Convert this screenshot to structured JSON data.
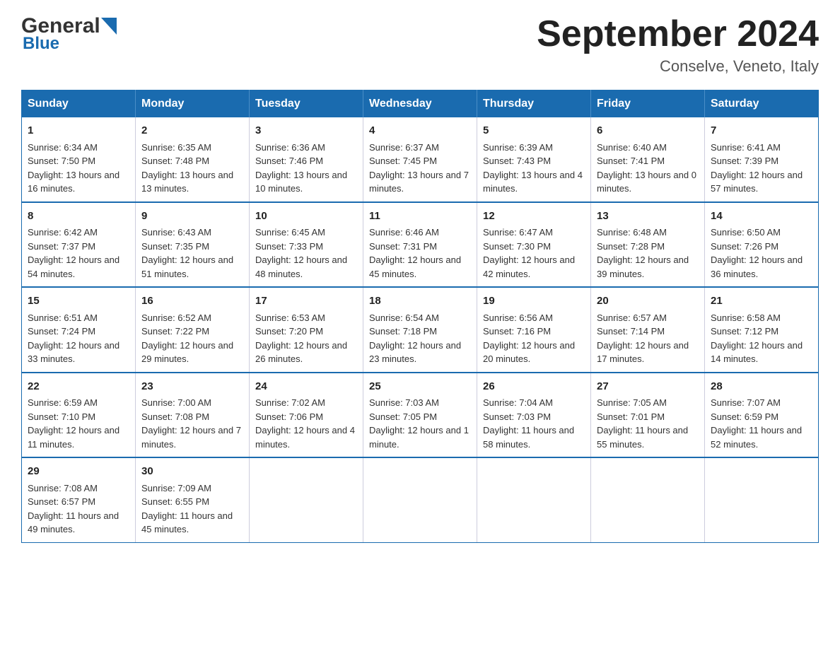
{
  "header": {
    "logo_general": "General",
    "logo_blue": "Blue",
    "month_title": "September 2024",
    "subtitle": "Conselve, Veneto, Italy"
  },
  "weekdays": [
    "Sunday",
    "Monday",
    "Tuesday",
    "Wednesday",
    "Thursday",
    "Friday",
    "Saturday"
  ],
  "weeks": [
    [
      {
        "day": "1",
        "sunrise": "Sunrise: 6:34 AM",
        "sunset": "Sunset: 7:50 PM",
        "daylight": "Daylight: 13 hours and 16 minutes."
      },
      {
        "day": "2",
        "sunrise": "Sunrise: 6:35 AM",
        "sunset": "Sunset: 7:48 PM",
        "daylight": "Daylight: 13 hours and 13 minutes."
      },
      {
        "day": "3",
        "sunrise": "Sunrise: 6:36 AM",
        "sunset": "Sunset: 7:46 PM",
        "daylight": "Daylight: 13 hours and 10 minutes."
      },
      {
        "day": "4",
        "sunrise": "Sunrise: 6:37 AM",
        "sunset": "Sunset: 7:45 PM",
        "daylight": "Daylight: 13 hours and 7 minutes."
      },
      {
        "day": "5",
        "sunrise": "Sunrise: 6:39 AM",
        "sunset": "Sunset: 7:43 PM",
        "daylight": "Daylight: 13 hours and 4 minutes."
      },
      {
        "day": "6",
        "sunrise": "Sunrise: 6:40 AM",
        "sunset": "Sunset: 7:41 PM",
        "daylight": "Daylight: 13 hours and 0 minutes."
      },
      {
        "day": "7",
        "sunrise": "Sunrise: 6:41 AM",
        "sunset": "Sunset: 7:39 PM",
        "daylight": "Daylight: 12 hours and 57 minutes."
      }
    ],
    [
      {
        "day": "8",
        "sunrise": "Sunrise: 6:42 AM",
        "sunset": "Sunset: 7:37 PM",
        "daylight": "Daylight: 12 hours and 54 minutes."
      },
      {
        "day": "9",
        "sunrise": "Sunrise: 6:43 AM",
        "sunset": "Sunset: 7:35 PM",
        "daylight": "Daylight: 12 hours and 51 minutes."
      },
      {
        "day": "10",
        "sunrise": "Sunrise: 6:45 AM",
        "sunset": "Sunset: 7:33 PM",
        "daylight": "Daylight: 12 hours and 48 minutes."
      },
      {
        "day": "11",
        "sunrise": "Sunrise: 6:46 AM",
        "sunset": "Sunset: 7:31 PM",
        "daylight": "Daylight: 12 hours and 45 minutes."
      },
      {
        "day": "12",
        "sunrise": "Sunrise: 6:47 AM",
        "sunset": "Sunset: 7:30 PM",
        "daylight": "Daylight: 12 hours and 42 minutes."
      },
      {
        "day": "13",
        "sunrise": "Sunrise: 6:48 AM",
        "sunset": "Sunset: 7:28 PM",
        "daylight": "Daylight: 12 hours and 39 minutes."
      },
      {
        "day": "14",
        "sunrise": "Sunrise: 6:50 AM",
        "sunset": "Sunset: 7:26 PM",
        "daylight": "Daylight: 12 hours and 36 minutes."
      }
    ],
    [
      {
        "day": "15",
        "sunrise": "Sunrise: 6:51 AM",
        "sunset": "Sunset: 7:24 PM",
        "daylight": "Daylight: 12 hours and 33 minutes."
      },
      {
        "day": "16",
        "sunrise": "Sunrise: 6:52 AM",
        "sunset": "Sunset: 7:22 PM",
        "daylight": "Daylight: 12 hours and 29 minutes."
      },
      {
        "day": "17",
        "sunrise": "Sunrise: 6:53 AM",
        "sunset": "Sunset: 7:20 PM",
        "daylight": "Daylight: 12 hours and 26 minutes."
      },
      {
        "day": "18",
        "sunrise": "Sunrise: 6:54 AM",
        "sunset": "Sunset: 7:18 PM",
        "daylight": "Daylight: 12 hours and 23 minutes."
      },
      {
        "day": "19",
        "sunrise": "Sunrise: 6:56 AM",
        "sunset": "Sunset: 7:16 PM",
        "daylight": "Daylight: 12 hours and 20 minutes."
      },
      {
        "day": "20",
        "sunrise": "Sunrise: 6:57 AM",
        "sunset": "Sunset: 7:14 PM",
        "daylight": "Daylight: 12 hours and 17 minutes."
      },
      {
        "day": "21",
        "sunrise": "Sunrise: 6:58 AM",
        "sunset": "Sunset: 7:12 PM",
        "daylight": "Daylight: 12 hours and 14 minutes."
      }
    ],
    [
      {
        "day": "22",
        "sunrise": "Sunrise: 6:59 AM",
        "sunset": "Sunset: 7:10 PM",
        "daylight": "Daylight: 12 hours and 11 minutes."
      },
      {
        "day": "23",
        "sunrise": "Sunrise: 7:00 AM",
        "sunset": "Sunset: 7:08 PM",
        "daylight": "Daylight: 12 hours and 7 minutes."
      },
      {
        "day": "24",
        "sunrise": "Sunrise: 7:02 AM",
        "sunset": "Sunset: 7:06 PM",
        "daylight": "Daylight: 12 hours and 4 minutes."
      },
      {
        "day": "25",
        "sunrise": "Sunrise: 7:03 AM",
        "sunset": "Sunset: 7:05 PM",
        "daylight": "Daylight: 12 hours and 1 minute."
      },
      {
        "day": "26",
        "sunrise": "Sunrise: 7:04 AM",
        "sunset": "Sunset: 7:03 PM",
        "daylight": "Daylight: 11 hours and 58 minutes."
      },
      {
        "day": "27",
        "sunrise": "Sunrise: 7:05 AM",
        "sunset": "Sunset: 7:01 PM",
        "daylight": "Daylight: 11 hours and 55 minutes."
      },
      {
        "day": "28",
        "sunrise": "Sunrise: 7:07 AM",
        "sunset": "Sunset: 6:59 PM",
        "daylight": "Daylight: 11 hours and 52 minutes."
      }
    ],
    [
      {
        "day": "29",
        "sunrise": "Sunrise: 7:08 AM",
        "sunset": "Sunset: 6:57 PM",
        "daylight": "Daylight: 11 hours and 49 minutes."
      },
      {
        "day": "30",
        "sunrise": "Sunrise: 7:09 AM",
        "sunset": "Sunset: 6:55 PM",
        "daylight": "Daylight: 11 hours and 45 minutes."
      },
      null,
      null,
      null,
      null,
      null
    ]
  ]
}
